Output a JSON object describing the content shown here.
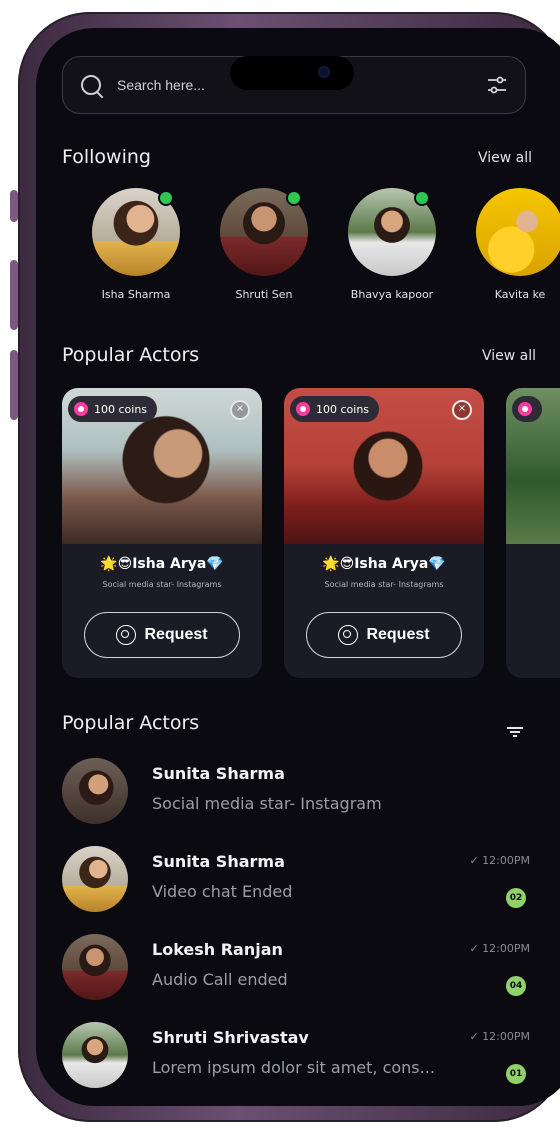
{
  "search": {
    "placeholder": "Search here..."
  },
  "following": {
    "title": "Following",
    "view_all": "View all",
    "items": [
      {
        "name": "Isha Sharma"
      },
      {
        "name": "Shruti Sen"
      },
      {
        "name": "Bhavya kapoor"
      },
      {
        "name": "Kavita ke"
      }
    ]
  },
  "popular_cards": {
    "title": "Popular Actors",
    "view_all": "View all",
    "cards": [
      {
        "coins": "100 coins",
        "name": "🌟😎Isha Arya💎",
        "subtitle": "Social media star- Instagrams",
        "request": "Request"
      },
      {
        "coins": "100 coins",
        "name": "🌟😎Isha Arya💎",
        "subtitle": "Social media star- Instagrams",
        "request": "Request"
      }
    ]
  },
  "popular_list": {
    "title": "Popular Actors",
    "items": [
      {
        "name": "Sunita Sharma",
        "subtitle": "Social media star- Instagram",
        "time": "",
        "count": ""
      },
      {
        "name": "Sunita Sharma",
        "subtitle": "Video chat Ended",
        "time": "✓ 12:00PM",
        "count": "02"
      },
      {
        "name": "Lokesh Ranjan",
        "subtitle": "Audio Call ended",
        "time": "✓ 12:00PM",
        "count": "04"
      },
      {
        "name": "Shruti Shrivastav",
        "subtitle": "Lorem ipsum dolor sit amet, cons...",
        "time": "✓ 12:00PM",
        "count": "01"
      }
    ]
  },
  "colors": {
    "background": "#0b0a10",
    "online": "#31c552",
    "badge": "#8fd16a",
    "coin": "#ff3aa0"
  }
}
